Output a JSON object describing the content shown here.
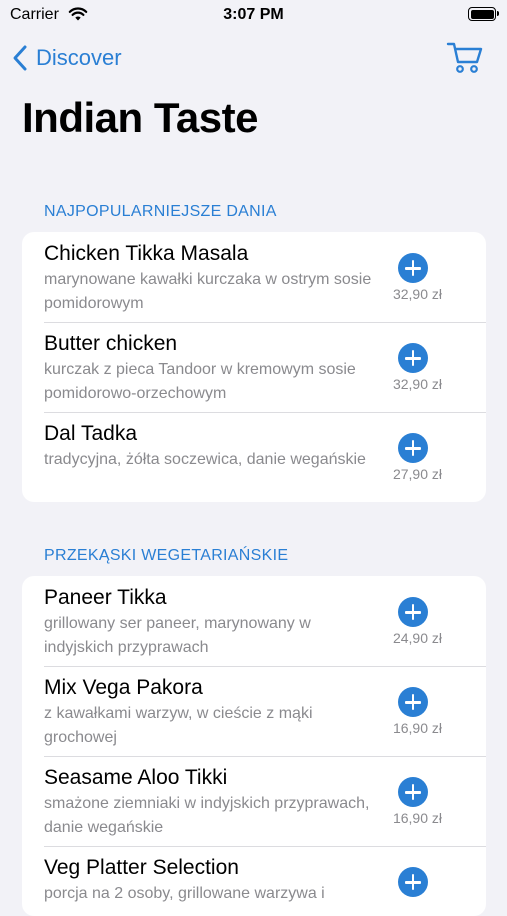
{
  "status_bar": {
    "carrier": "Carrier",
    "time": "3:07 PM"
  },
  "nav": {
    "back_label": "Discover"
  },
  "title": "Indian Taste",
  "colors": {
    "accent": "#2a7fd4",
    "background": "#f2f2f7",
    "secondary_text": "#8a8a8e"
  },
  "icons": {
    "back": "chevron-left-icon",
    "cart": "cart-icon",
    "add": "plus-circle-icon",
    "wifi": "wifi-icon",
    "battery": "battery-icon"
  },
  "sections": [
    {
      "header": "NAJPOPULARNIEJSZE DANIA",
      "items": [
        {
          "name": "Chicken Tikka Masala",
          "desc": "marynowane kawałki kurczaka w ostrym sosie pomidorowym",
          "price": "32,90 zł"
        },
        {
          "name": "Butter chicken",
          "desc": "kurczak z pieca Tandoor w kremowym sosie pomidorowo-orzechowym",
          "price": "32,90 zł"
        },
        {
          "name": "Dal Tadka",
          "desc": "tradycyjna, żółta soczewica, danie wegańskie",
          "price": "27,90 zł"
        }
      ]
    },
    {
      "header": "PRZEKĄSKI WEGETARIAŃSKIE",
      "items": [
        {
          "name": "Paneer Tikka",
          "desc": "grillowany ser paneer, marynowany w indyjskich przyprawach",
          "price": "24,90 zł"
        },
        {
          "name": "Mix Vega Pakora",
          "desc": "z kawałkami warzyw, w cieście z mąki grochowej",
          "price": "16,90 zł"
        },
        {
          "name": "Seasame Aloo Tikki",
          "desc": "smażone ziemniaki w indyjskich przyprawach, danie wegańskie",
          "price": "16,90 zł"
        },
        {
          "name": "Veg Platter Selection",
          "desc": "porcja na 2 osoby, grillowane warzywa i",
          "price": ""
        }
      ]
    }
  ]
}
